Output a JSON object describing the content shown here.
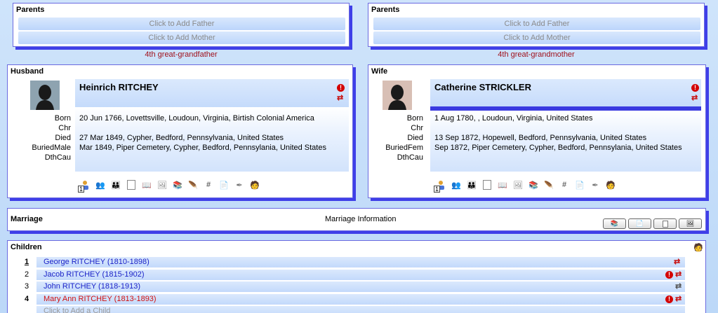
{
  "colors": {
    "accent_shadow": "#3f3fe8",
    "relationship": "#a0101a",
    "link": "#1a22c8",
    "child_female": "#d01010",
    "error": "#d40000"
  },
  "parents_left": {
    "title": "Parents",
    "add_father": "Click to Add Father",
    "add_mother": "Click to Add Mother",
    "relationship": "4th great-grandfather"
  },
  "parents_right": {
    "title": "Parents",
    "add_father": "Click to Add Father",
    "add_mother": "Click to Add Mother",
    "relationship": "4th great-grandmother"
  },
  "husband": {
    "title": "Husband",
    "name": "Heinrich RITCHEY",
    "labels": [
      "Born",
      "Chr",
      "Died",
      "BuriedMale",
      "DthCau"
    ],
    "values": [
      "20 Jun 1766, Lovettsville, Loudoun, Virginia, Birtish Colonial America",
      "",
      "27 Mar 1849, Cypher, Bedford, Pennsylvania, United States",
      "Mar 1849, Piper Cemetery, Cypher, Bedford, Pennsylania, United States",
      ""
    ],
    "toolbar_index": "1",
    "icons": [
      "male-person-icon",
      "people-icon",
      "family-icon",
      "note-icon",
      "book-icon",
      "picture-icon",
      "library-icon",
      "feather-icon",
      "hash-icon",
      "document-icon",
      "pen-icon",
      "edit-person-icon"
    ]
  },
  "wife": {
    "title": "Wife",
    "name": "Catherine STRICKLER",
    "labels": [
      "Born",
      "Chr",
      "Died",
      "BuriedFem",
      "DthCau"
    ],
    "values": [
      "1 Aug 1780, , Loudoun, Virginia, United States",
      "",
      "13 Sep 1872, Hopewell, Bedford, Pennsylvania, United States",
      "Sep 1872, Piper Cemetery, Cypher, Bedford, Pennsylania, United States",
      ""
    ],
    "toolbar_index": "1",
    "icons": [
      "female-person-icon",
      "people-icon",
      "family-icon",
      "note-icon",
      "book-icon",
      "picture-icon",
      "library-icon",
      "feather-icon",
      "hash-icon",
      "document-icon",
      "pen-icon",
      "edit-person-icon"
    ]
  },
  "marriage": {
    "title": "Marriage",
    "info": "Marriage Information"
  },
  "children": {
    "title": "Children",
    "items": [
      {
        "num": "1",
        "label": "George RITCHEY (1810-1898)",
        "sex": "male",
        "error": false
      },
      {
        "num": "2",
        "label": "Jacob RITCHEY (1815-1902)",
        "sex": "male",
        "error": true
      },
      {
        "num": "3",
        "label": "John RITCHEY (1818-1913)",
        "sex": "male",
        "error": false
      },
      {
        "num": "4",
        "label": "Mary Ann RITCHEY (1813-1893)",
        "sex": "female",
        "error": true
      }
    ],
    "add_child": "Click to Add a Child"
  }
}
